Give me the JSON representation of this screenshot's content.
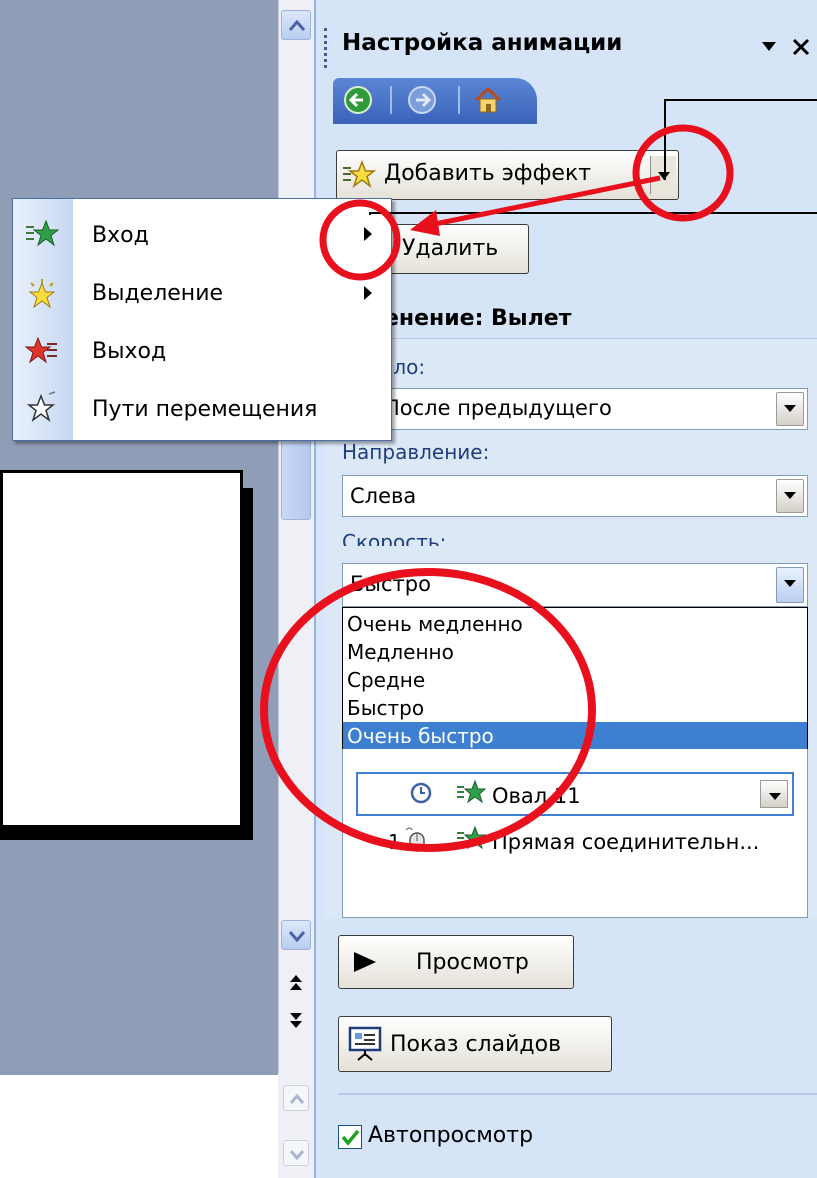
{
  "task_pane": {
    "title": "Настройка анимации",
    "add_effect_label": "Добавить эффект",
    "remove_label": "Удалить",
    "effect_heading": "енение: Вылет",
    "start_label": "Начало:",
    "start_value": "После предыдущего",
    "direction_label": "Направление:",
    "direction_value": "Слева",
    "speed_label": "Скорость:",
    "speed_value": "Быстро",
    "speed_options": [
      "Очень медленно",
      "Медленно",
      "Средне",
      "Быстро",
      "Очень быстро"
    ],
    "selected_speed_index": 4,
    "list_items": [
      {
        "order": "",
        "name": "Овал 11"
      },
      {
        "order": "1",
        "name": "Прямая соединительн..."
      }
    ],
    "play_label": "Просмотр",
    "slideshow_label": "Показ слайдов",
    "autopreview_label": "Автопросмотр",
    "autopreview_checked": true
  },
  "add_effect_menu": {
    "items": [
      {
        "label": "Вход",
        "icon": "entrance-star-icon",
        "submenu": true
      },
      {
        "label": "Выделение",
        "icon": "emphasis-star-icon",
        "submenu": true
      },
      {
        "label": "Выход",
        "icon": "exit-star-icon",
        "submenu": false
      },
      {
        "label": "Пути перемещения",
        "icon": "motion-path-star-icon",
        "submenu": false
      }
    ]
  },
  "colors": {
    "pane_bg": "#d6e4f7",
    "selection": "#3d7fd0",
    "annotation_red": "#e8101c",
    "background": "#4a5b6e"
  }
}
